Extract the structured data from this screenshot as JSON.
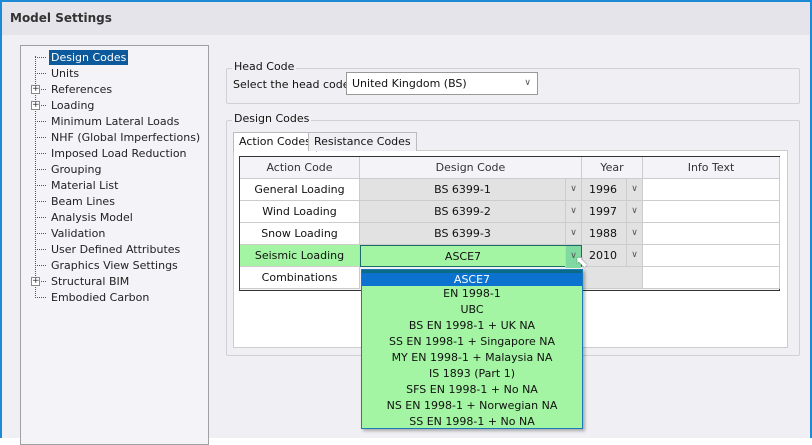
{
  "title": "Model Settings",
  "tree": [
    {
      "label": "Design Codes",
      "selected": true,
      "expandable": false
    },
    {
      "label": "Units",
      "expandable": false
    },
    {
      "label": "References",
      "expandable": true
    },
    {
      "label": "Loading",
      "expandable": true
    },
    {
      "label": "Minimum Lateral Loads",
      "expandable": false
    },
    {
      "label": "NHF (Global Imperfections)",
      "expandable": false
    },
    {
      "label": "Imposed Load Reduction",
      "expandable": false
    },
    {
      "label": "Grouping",
      "expandable": false
    },
    {
      "label": "Material List",
      "expandable": false
    },
    {
      "label": "Beam Lines",
      "expandable": false
    },
    {
      "label": "Analysis Model",
      "expandable": false
    },
    {
      "label": "Validation",
      "expandable": false
    },
    {
      "label": "User Defined Attributes",
      "expandable": false
    },
    {
      "label": "Graphics View Settings",
      "expandable": false
    },
    {
      "label": "Structural BIM",
      "expandable": true
    },
    {
      "label": "Embodied Carbon",
      "expandable": false
    }
  ],
  "head_code": {
    "group": "Head Code",
    "label": "Select the head code",
    "value": "United Kingdom (BS)"
  },
  "design_codes": {
    "group": "Design Codes",
    "tabs": [
      "Action Codes",
      "Resistance Codes"
    ],
    "columns": [
      "Action Code",
      "Design Code",
      "Year",
      "Info Text"
    ],
    "rows": [
      {
        "action": "General Loading",
        "code": "BS 6399-1",
        "year": "1996",
        "info": ""
      },
      {
        "action": "Wind Loading",
        "code": "BS 6399-2",
        "year": "1997",
        "info": ""
      },
      {
        "action": "Snow Loading",
        "code": "BS 6399-3",
        "year": "1988",
        "info": ""
      },
      {
        "action": "Seismic Loading",
        "code": "ASCE7",
        "year": "2010",
        "info": ""
      },
      {
        "action": "Combinations",
        "code": "",
        "year": "",
        "info": ""
      }
    ]
  },
  "dropdown_options": [
    "ASCE7",
    "EN 1998-1",
    "UBC",
    "BS EN 1998-1 + UK NA",
    "SS EN 1998-1 + Singapore NA",
    "MY EN 1998-1 + Malaysia NA",
    "IS 1893 (Part 1)",
    "SFS EN 1998-1 + No NA",
    "NS EN 1998-1 + Norwegian NA",
    "SS EN 1998-1 + No NA"
  ],
  "colors": {
    "selection": "#0c5a9c",
    "highlight_row": "#a3f5a3",
    "dropdown_selected": "#0b73cf",
    "window_border": "#1e8ad6"
  }
}
